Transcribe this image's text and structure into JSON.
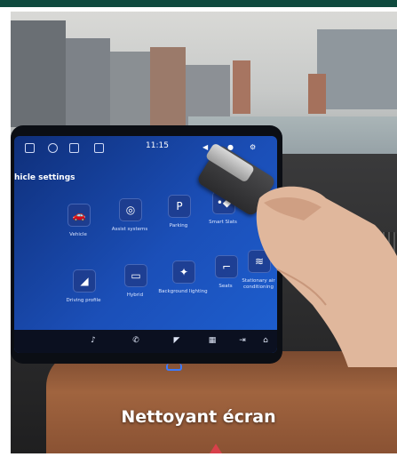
{
  "caption": "Nettoyant écran",
  "screen": {
    "time": "11:15",
    "heading": "hicle settings",
    "tiles": [
      {
        "label": "Vehicle",
        "icon": "car-icon"
      },
      {
        "label": "Assist systems",
        "icon": "assist-icon"
      },
      {
        "label": "Parking",
        "icon": "parking-icon"
      },
      {
        "label": "Smart Slats",
        "icon": "slats-icon"
      },
      {
        "label": "Driving profile",
        "icon": "driving-profile-icon"
      },
      {
        "label": "Hybrid",
        "icon": "battery-icon"
      },
      {
        "label": "Background lighting",
        "icon": "lighting-icon"
      },
      {
        "label": "Seats",
        "icon": "seat-icon"
      },
      {
        "label": "Stationary air conditioning",
        "icon": "climate-icon"
      }
    ]
  },
  "colors": {
    "brand_bar": "#0f4a3e",
    "screen_blue": "#1b4fb8",
    "caption_text": "#ffffff",
    "bookmark": "#d8404a"
  }
}
